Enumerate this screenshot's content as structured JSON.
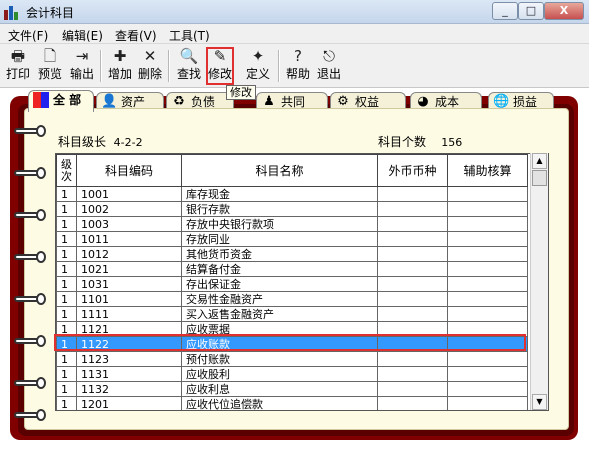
{
  "window": {
    "title": "会计科目",
    "min": "_",
    "max": "□",
    "close": "X"
  },
  "menu": [
    "文件(F)",
    "编辑(E)",
    "查看(V)",
    "工具(T)"
  ],
  "toolbar": {
    "print": "打印",
    "preview": "预览",
    "export": "输出",
    "add": "增加",
    "delete": "删除",
    "find": "查找",
    "edit": "修改",
    "define": "定义",
    "help": "帮助",
    "exit": "退出"
  },
  "tooltip": "修改",
  "tabs": [
    "全 部",
    "资产",
    "负债",
    "共同",
    "权益",
    "成本",
    "损益"
  ],
  "info": {
    "level_label": "科目级长",
    "level_value": "4-2-2",
    "count_label": "科目个数",
    "count_value": "156"
  },
  "grid": {
    "headers": [
      "级次",
      "科目编码",
      "科目名称",
      "外币币种",
      "辅助核算"
    ],
    "rows": [
      [
        "1",
        "1001",
        "库存现金"
      ],
      [
        "1",
        "1002",
        "银行存款"
      ],
      [
        "1",
        "1003",
        "存放中央银行款项"
      ],
      [
        "1",
        "1011",
        "存放同业"
      ],
      [
        "1",
        "1012",
        "其他货币资金"
      ],
      [
        "1",
        "1021",
        "结算备付金"
      ],
      [
        "1",
        "1031",
        "存出保证金"
      ],
      [
        "1",
        "1101",
        "交易性金融资产"
      ],
      [
        "1",
        "1111",
        "买入返售金融资产"
      ],
      [
        "1",
        "1121",
        "应收票据"
      ],
      [
        "1",
        "1122",
        "应收账款"
      ],
      [
        "1",
        "1123",
        "预付账款"
      ],
      [
        "1",
        "1131",
        "应收股利"
      ],
      [
        "1",
        "1132",
        "应收利息"
      ],
      [
        "1",
        "1201",
        "应收代位追偿款"
      ]
    ],
    "selected_row": 10
  },
  "colors": {
    "frame": "#800000",
    "paper": "#fdfbe4",
    "selection": "#3399ff",
    "highlight": "#e03030"
  }
}
